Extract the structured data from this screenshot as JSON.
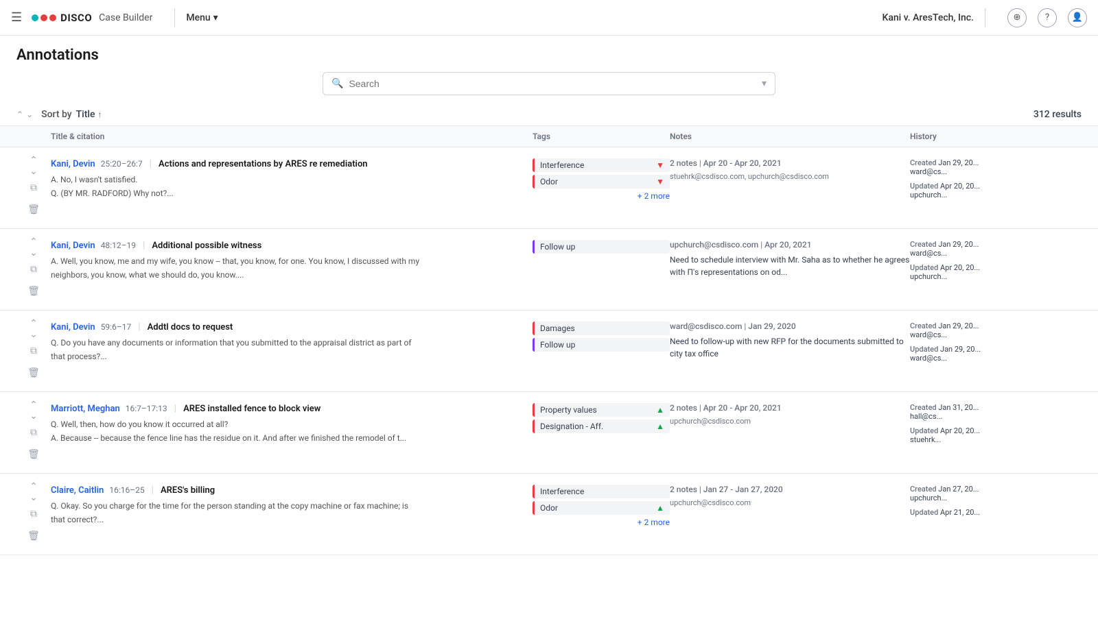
{
  "app": {
    "logo": "DISCO",
    "product": "Case Builder",
    "nav_menu": "Menu",
    "case_title": "Kani v. AresTech, Inc."
  },
  "search": {
    "placeholder": "Search",
    "value": ""
  },
  "controls": {
    "sort_by_label": "Sort by",
    "sort_field": "Title",
    "results_count": "312 results"
  },
  "table": {
    "col_title": "Title & citation",
    "col_tags": "Tags",
    "col_notes": "Notes",
    "col_history": "History"
  },
  "annotations": [
    {
      "id": 1,
      "witness": "Kani, Devin",
      "citation": "25:20–26:7",
      "title": "Actions and representations by ARES re remediation",
      "excerpt_lines": [
        "A. No, I wasn't satisfied.",
        "Q. (BY MR. RADFORD) Why not?..."
      ],
      "tags": [
        {
          "label": "Interference",
          "color": "red",
          "arrow": "down"
        },
        {
          "label": "Odor",
          "color": "red",
          "arrow": "down"
        }
      ],
      "more_tags": "+ 2 more",
      "notes_count": "2 notes",
      "notes_date": "Apr 20 - Apr 20, 2021",
      "notes_authors": "stuehrk@csdisco.com, upchurch@csdisco.com",
      "notes_text": "",
      "history": [
        {
          "label": "Created",
          "date": "Jan 29, 20...",
          "user": "ward@cs..."
        },
        {
          "label": "Updated",
          "date": "Apr 20, 20...",
          "user": "upchurch..."
        }
      ]
    },
    {
      "id": 2,
      "witness": "Kani, Devin",
      "citation": "48:12–19",
      "title": "Additional possible witness",
      "excerpt_lines": [
        "A. Well, you know, me and my wife, you know -- that, you know, for one. You know, I discussed with my",
        "neighbors, you know, what we should do, you know...."
      ],
      "tags": [
        {
          "label": "Follow up",
          "color": "purple",
          "arrow": null
        }
      ],
      "more_tags": "",
      "notes_count": "",
      "notes_date": "Apr 20, 2021",
      "notes_authors": "upchurch@csdisco.com",
      "notes_text": "Need to schedule interview with Mr. Saha as to whether he agrees with Π's representations on od...",
      "history": [
        {
          "label": "Created",
          "date": "Jan 29, 20...",
          "user": "ward@cs..."
        },
        {
          "label": "Updated",
          "date": "Apr 20, 20...",
          "user": "upchurch..."
        }
      ]
    },
    {
      "id": 3,
      "witness": "Kani, Devin",
      "citation": "59:6–17",
      "title": "Addtl docs to request",
      "excerpt_lines": [
        "Q. Do you have any documents or information that you submitted to the appraisal district as part of",
        "that process?..."
      ],
      "tags": [
        {
          "label": "Damages",
          "color": "red",
          "arrow": null
        },
        {
          "label": "Follow up",
          "color": "purple",
          "arrow": null
        }
      ],
      "more_tags": "",
      "notes_count": "",
      "notes_date": "Jan 29, 2020",
      "notes_authors": "ward@csdisco.com",
      "notes_text": "Need to follow-up with new RFP for the documents submitted to city tax office",
      "history": [
        {
          "label": "Created",
          "date": "Jan 29, 20...",
          "user": "ward@cs..."
        },
        {
          "label": "Updated",
          "date": "Jan 29, 20...",
          "user": "ward@cs..."
        }
      ]
    },
    {
      "id": 4,
      "witness": "Marriott, Meghan",
      "citation": "16:7–17:13",
      "title": "ARES installed fence to block view",
      "excerpt_lines": [
        "Q. Well, then, how do you know it occurred at all?",
        "A. Because -- because the fence line has the residue on it. And after we finished the remodel of t..."
      ],
      "tags": [
        {
          "label": "Property values",
          "color": "red",
          "arrow": "up"
        },
        {
          "label": "Designation - Aff.",
          "color": "red",
          "arrow": "up"
        }
      ],
      "more_tags": "",
      "notes_count": "2 notes",
      "notes_date": "Apr 20 - Apr 20, 2021",
      "notes_authors": "upchurch@csdisco.com",
      "notes_text": "",
      "history": [
        {
          "label": "Created",
          "date": "Jan 31, 20...",
          "user": "hall@cs..."
        },
        {
          "label": "Updated",
          "date": "Apr 20, 20...",
          "user": "stuehrk..."
        }
      ]
    },
    {
      "id": 5,
      "witness": "Claire, Caitlin",
      "citation": "16:16–25",
      "title": "ARES's billing",
      "excerpt_lines": [
        "Q. Okay. So you charge for the time for the person standing at the copy machine or fax machine; is",
        "that correct?..."
      ],
      "tags": [
        {
          "label": "Interference",
          "color": "red",
          "arrow": null
        },
        {
          "label": "Odor",
          "color": "red",
          "arrow": "up"
        }
      ],
      "more_tags": "+ 2 more",
      "notes_count": "2 notes",
      "notes_date": "Jan 27 - Jan 27, 2020",
      "notes_authors": "upchurch@csdisco.com",
      "notes_text": "",
      "history": [
        {
          "label": "Created",
          "date": "Jan 27, 20...",
          "user": "upchurch..."
        },
        {
          "label": "Updated",
          "date": "Apr 21, 20...",
          "user": ""
        }
      ]
    }
  ]
}
